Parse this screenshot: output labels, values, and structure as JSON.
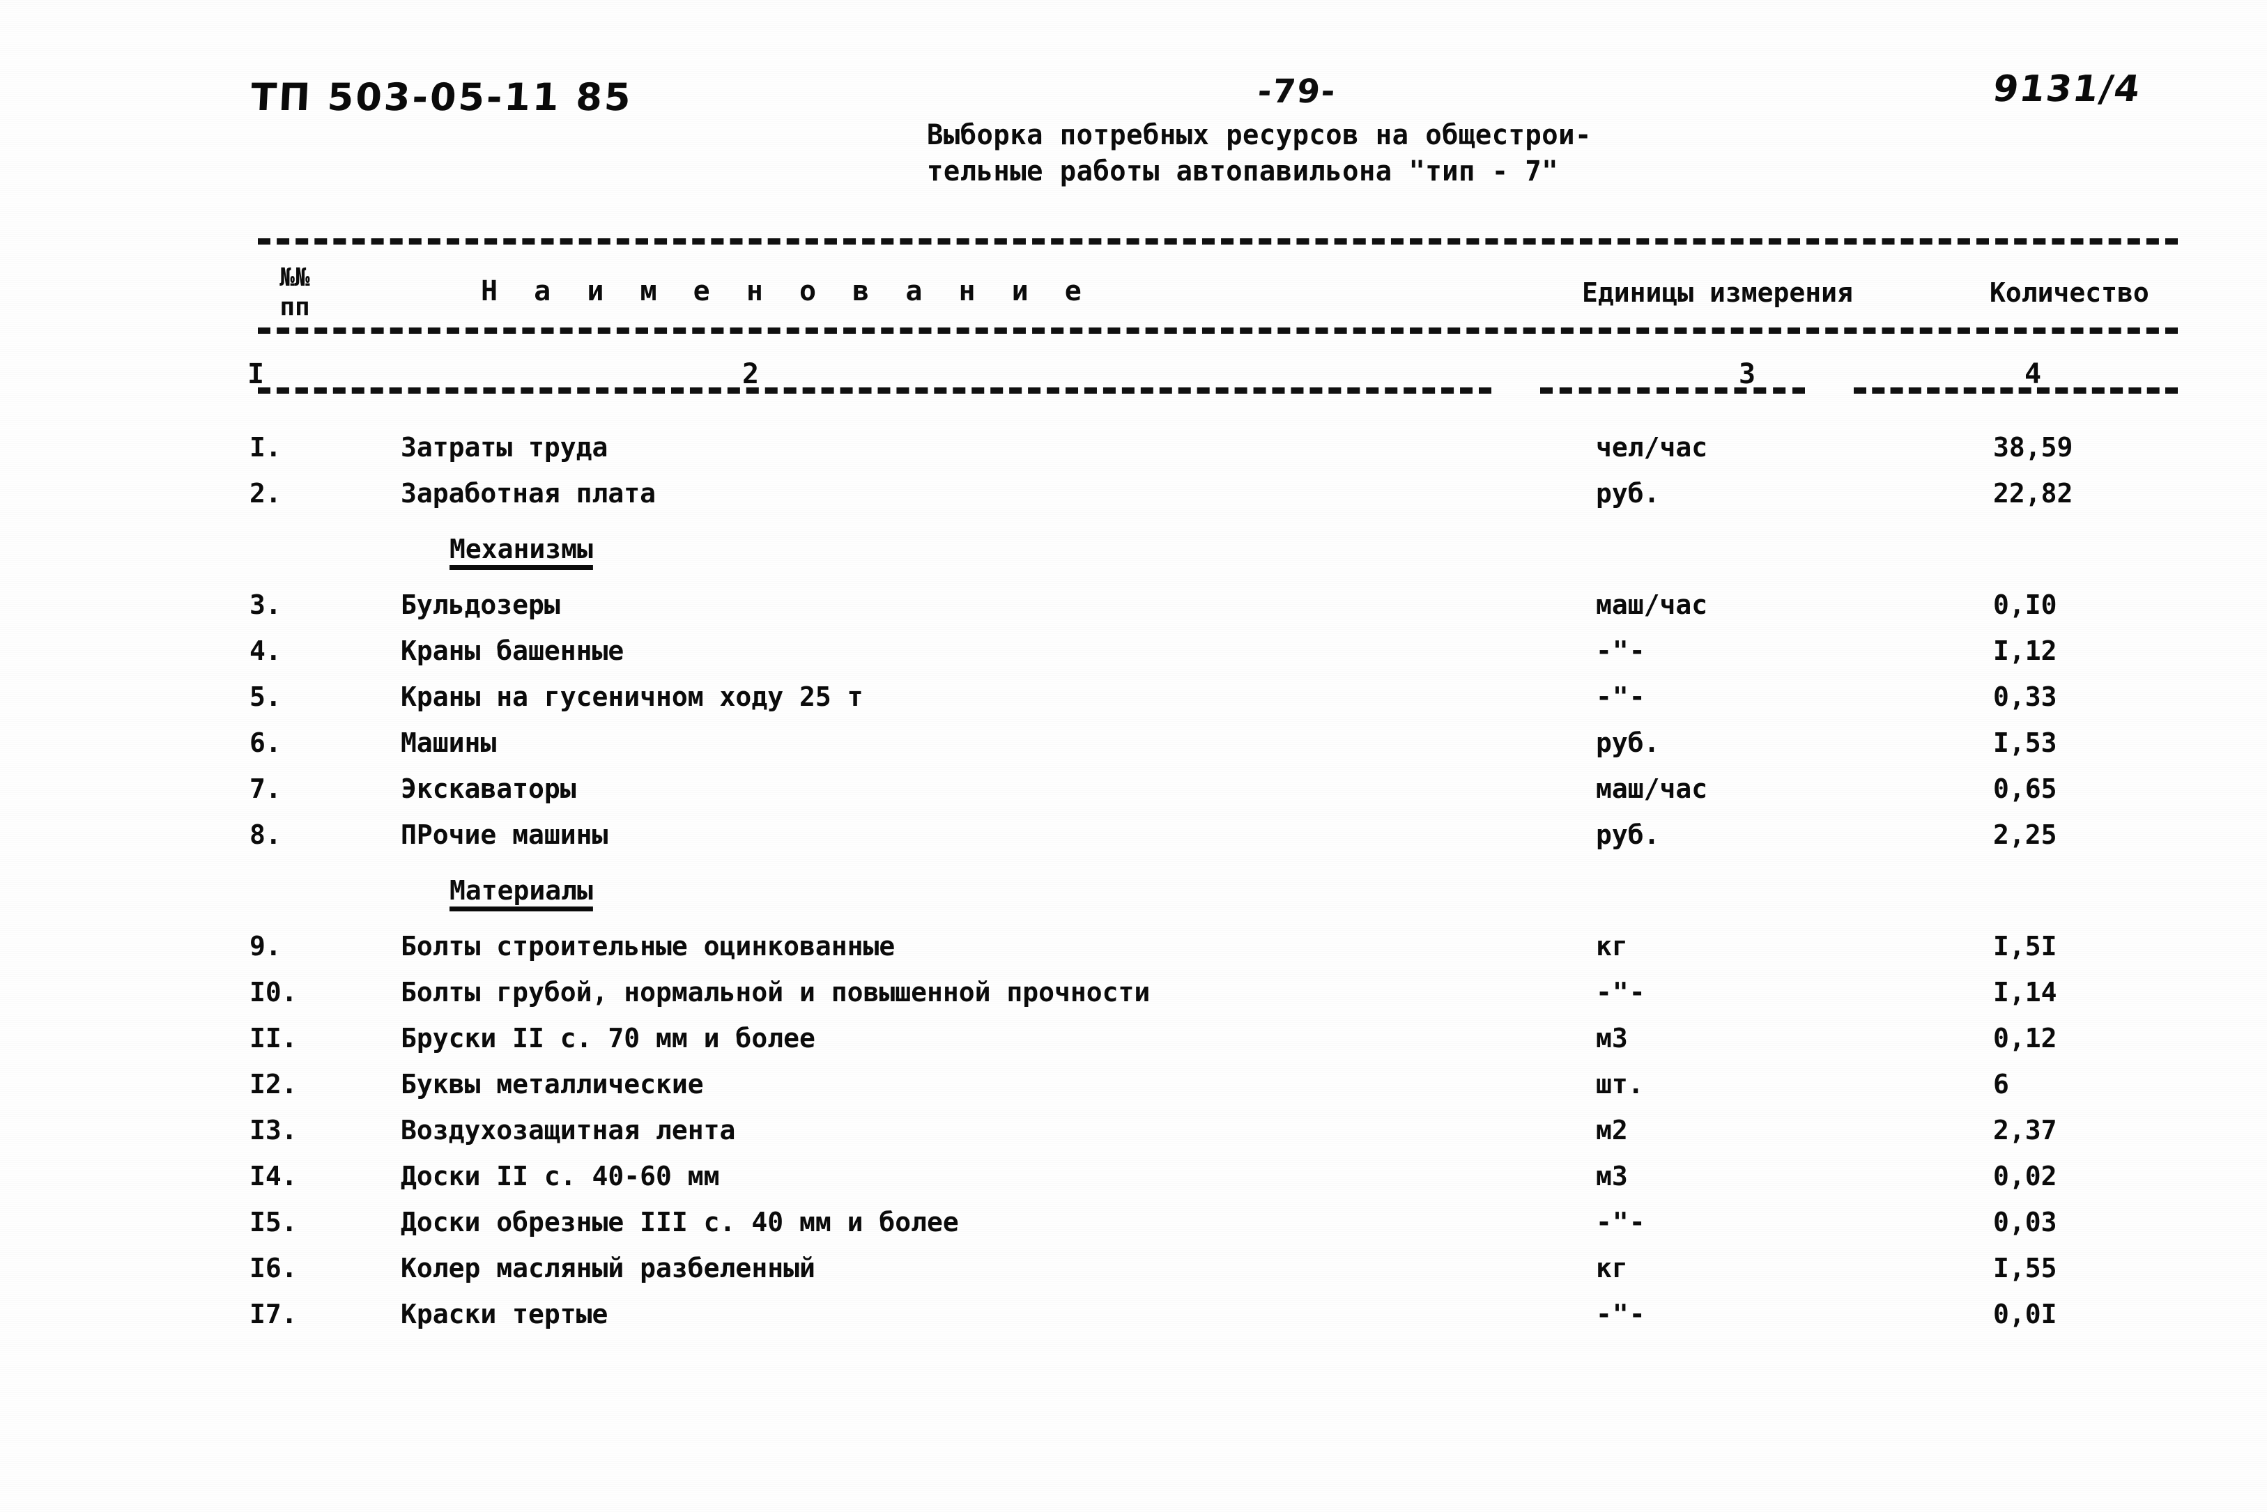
{
  "header": {
    "doc_code": "ТП 503-05-11 85",
    "page_number": "-79-",
    "archive_code": "9131/4",
    "title_line1": "Выборка потребных ресурсов на общестрои-",
    "title_line2": "тельные работы автопавильона \"тип - 7\""
  },
  "table": {
    "columns": {
      "no_line1": "№№",
      "no_line2": "пп",
      "name": "Н а и м е н о в а н и е",
      "units": "Единицы измерения",
      "quantity": "Количество"
    },
    "column_indices": {
      "c1": "I",
      "c2": "2",
      "c3": "3",
      "c4": "4"
    },
    "rows": [
      {
        "no": "I.",
        "name": "Затраты труда",
        "unit": "чел/час",
        "qty": "38,59",
        "section": false
      },
      {
        "no": "2.",
        "name": "Заработная плата",
        "unit": "руб.",
        "qty": "22,82",
        "section": false
      },
      {
        "no": "",
        "name": "Механизмы",
        "unit": "",
        "qty": "",
        "section": true
      },
      {
        "no": "3.",
        "name": "Бульдозеры",
        "unit": "маш/час",
        "qty": "0,I0",
        "section": false
      },
      {
        "no": "4.",
        "name": "Краны башенные",
        "unit": "-\"-",
        "qty": "I,12",
        "section": false
      },
      {
        "no": "5.",
        "name": "Краны на гусеничном ходу 25 т",
        "unit": "-\"-",
        "qty": "0,33",
        "section": false
      },
      {
        "no": "6.",
        "name": "Машины",
        "unit": "руб.",
        "qty": "I,53",
        "section": false
      },
      {
        "no": "7.",
        "name": "Экскаваторы",
        "unit": "маш/час",
        "qty": "0,65",
        "section": false
      },
      {
        "no": "8.",
        "name": "ПРочие машины",
        "unit": "руб.",
        "qty": "2,25",
        "section": false
      },
      {
        "no": "",
        "name": "Материалы",
        "unit": "",
        "qty": "",
        "section": true
      },
      {
        "no": "9.",
        "name": "Болты строительные оцинкованные",
        "unit": "кг",
        "qty": "I,5I",
        "section": false
      },
      {
        "no": "I0.",
        "name": "Болты грубой, нормальной и повышенной прочности",
        "unit": "-\"-",
        "qty": "I,14",
        "section": false
      },
      {
        "no": "II.",
        "name": "Бруски II с. 70 мм и более",
        "unit": "м3",
        "qty": "0,12",
        "section": false
      },
      {
        "no": "I2.",
        "name": "Буквы металлические",
        "unit": "шт.",
        "qty": "6",
        "section": false
      },
      {
        "no": "I3.",
        "name": "Воздухозащитная лента",
        "unit": "м2",
        "qty": "2,37",
        "section": false
      },
      {
        "no": "I4.",
        "name": "Доски II с. 40-60 мм",
        "unit": "м3",
        "qty": "0,02",
        "section": false
      },
      {
        "no": "I5.",
        "name": "Доски обрезные III с. 40 мм и более",
        "unit": "-\"-",
        "qty": "0,03",
        "section": false
      },
      {
        "no": "I6.",
        "name": "Колер масляный разбеленный",
        "unit": "кг",
        "qty": "I,55",
        "section": false
      },
      {
        "no": "I7.",
        "name": "Краски тертые",
        "unit": "-\"-",
        "qty": "0,0I",
        "section": false
      }
    ]
  }
}
